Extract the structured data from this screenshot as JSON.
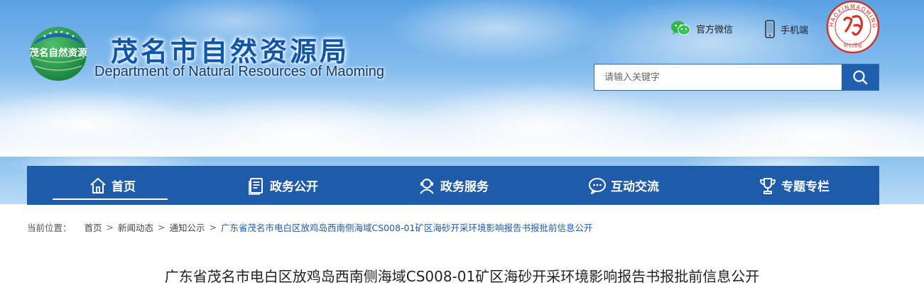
{
  "header": {
    "title": "茂名市自然资源局",
    "subtitle": "Department of Natural Resources of Maoming",
    "emblem_text": "茂名自然资源",
    "seal_text": "HAOXINMAOMING",
    "seal_bottom_text": "好心茂名",
    "wechat_label": "官方微信",
    "mobile_label": "手机端"
  },
  "search": {
    "placeholder": "请输入关键字"
  },
  "nav": {
    "items": [
      {
        "label": "首页",
        "icon": "home-icon"
      },
      {
        "label": "政务公开",
        "icon": "document-icon"
      },
      {
        "label": "政务服务",
        "icon": "service-person-icon"
      },
      {
        "label": "互动交流",
        "icon": "chat-bubble-icon"
      },
      {
        "label": "专题专栏",
        "icon": "trophy-icon"
      }
    ]
  },
  "breadcrumb": {
    "label": "当前位置：",
    "items": [
      "首页",
      "新闻动态",
      "通知公示"
    ],
    "separator": ">",
    "current": "广东省茂名市电白区放鸡岛西南侧海域CS008-01矿区海砂开采环境影响报告书报批前信息公开"
  },
  "article": {
    "title": "广东省茂名市电白区放鸡岛西南侧海域CS008-01矿区海砂开采环境影响报告书报批前信息公开"
  },
  "colors": {
    "nav_bg": "#1e5ba8",
    "title_blue": "#0f55a8",
    "emblem_green": "#1f9a4a",
    "seal_red": "#d0342c"
  }
}
